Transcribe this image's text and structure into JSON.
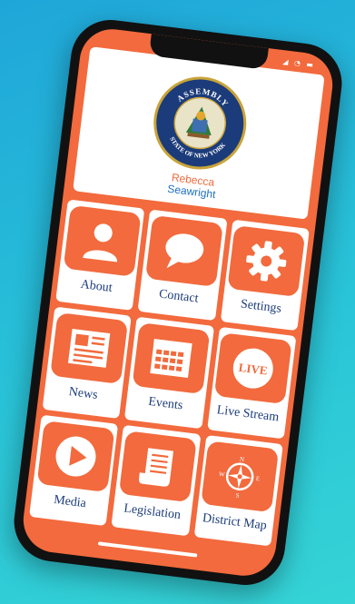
{
  "header": {
    "seal_text_top": "ASSEMBLY",
    "seal_text_bottom": "STATE OF NEW YORK",
    "first_name": "Rebecca",
    "last_name": "Seawright"
  },
  "status": {
    "icons": "◢ ◔ ▬"
  },
  "tiles": [
    {
      "label": "About",
      "icon": "person-icon"
    },
    {
      "label": "Contact",
      "icon": "chat-bubble-icon"
    },
    {
      "label": "Settings",
      "icon": "gear-icon"
    },
    {
      "label": "News",
      "icon": "newspaper-icon"
    },
    {
      "label": "Events",
      "icon": "calendar-icon"
    },
    {
      "label": "Live Stream",
      "icon": "live-icon",
      "icon_text": "LIVE"
    },
    {
      "label": "Media",
      "icon": "play-icon"
    },
    {
      "label": "Legislation",
      "icon": "scroll-icon"
    },
    {
      "label": "District Map",
      "icon": "compass-icon",
      "compass": [
        "N",
        "E",
        "S",
        "W"
      ]
    }
  ],
  "colors": {
    "accent": "#f26a3d",
    "label": "#1d3d7a",
    "background_start": "#1fa6d9",
    "background_end": "#35d4d6"
  }
}
